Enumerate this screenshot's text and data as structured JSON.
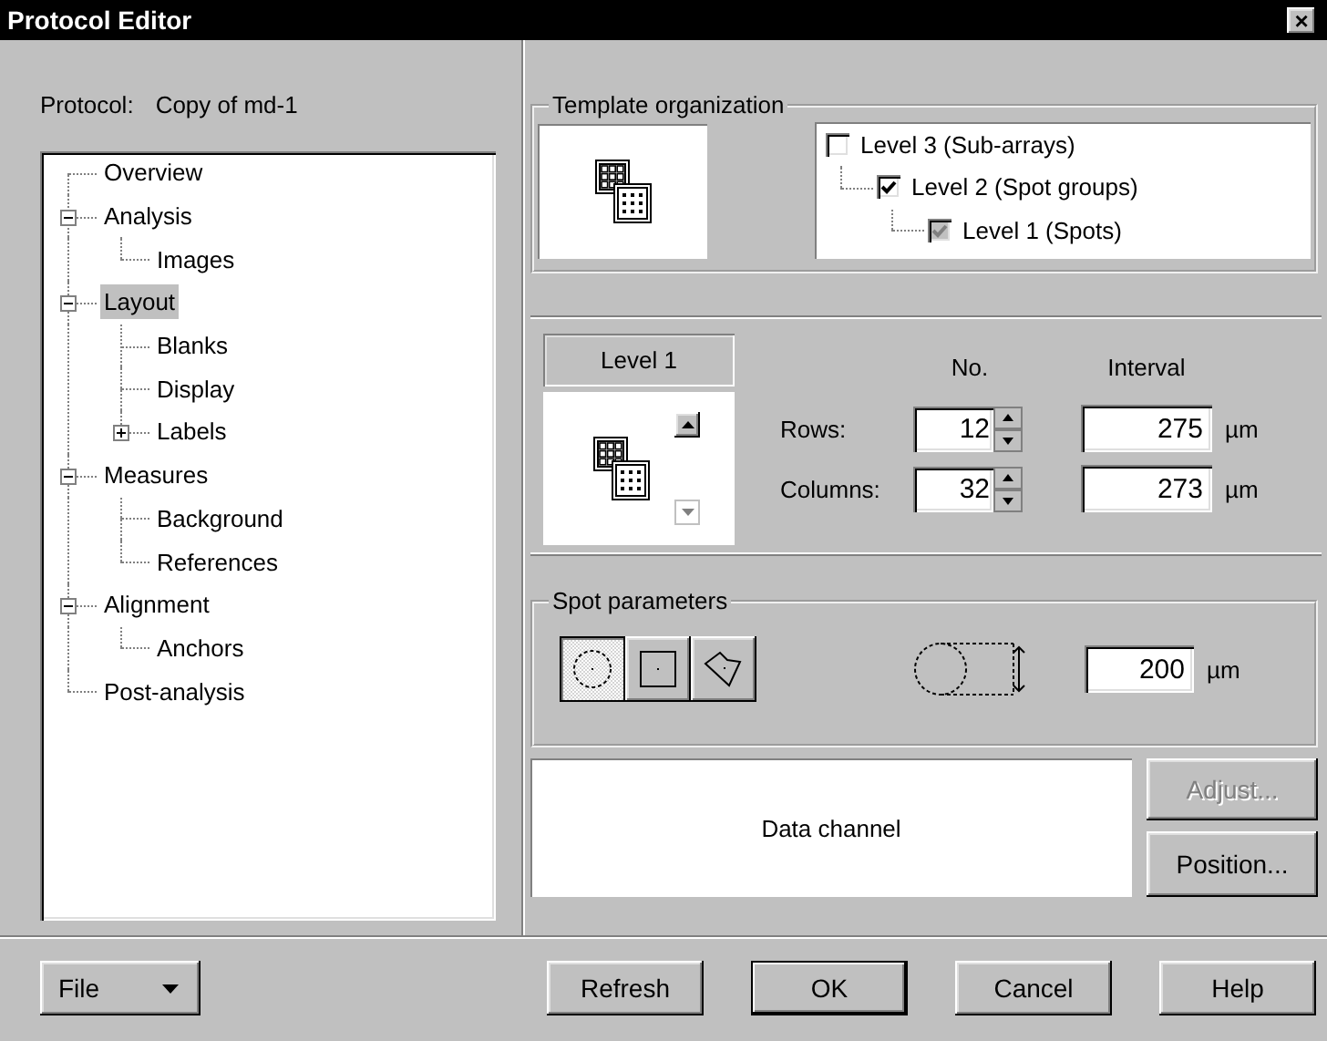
{
  "window": {
    "title": "Protocol Editor",
    "close": "×"
  },
  "protocol": {
    "label": "Protocol:",
    "name": "Copy of md-1"
  },
  "tree": [
    {
      "label": "Overview",
      "selected": false
    },
    {
      "label": "Analysis",
      "selected": false,
      "expanded": true,
      "children": [
        {
          "label": "Images",
          "selected": false
        }
      ]
    },
    {
      "label": "Layout",
      "selected": true,
      "expanded": true,
      "children": [
        {
          "label": "Blanks",
          "selected": false
        },
        {
          "label": "Display",
          "selected": false
        },
        {
          "label": "Labels",
          "selected": false,
          "expanded": false
        }
      ]
    },
    {
      "label": "Measures",
      "selected": false,
      "expanded": true,
      "children": [
        {
          "label": "Background",
          "selected": false
        },
        {
          "label": "References",
          "selected": false
        }
      ]
    },
    {
      "label": "Alignment",
      "selected": false,
      "expanded": true,
      "children": [
        {
          "label": "Anchors",
          "selected": false
        }
      ]
    },
    {
      "label": "Post-analysis",
      "selected": false
    }
  ],
  "template_organization": {
    "title": "Template organization",
    "levels": [
      {
        "label": "Level 3 (Sub-arrays)",
        "checked": false,
        "disabled": false,
        "children": [
          {
            "label": "Level 2 (Spot groups)",
            "checked": true,
            "disabled": false,
            "children": [
              {
                "label": "Level 1 (Spots)",
                "checked": true,
                "disabled": true
              }
            ]
          }
        ]
      }
    ]
  },
  "level_panel": {
    "title": "Level 1",
    "scroll_buttons": [
      {
        "kind": "up",
        "disabled": false
      },
      {
        "kind": "down",
        "disabled": true
      }
    ],
    "headers": [
      "No.",
      "Interval"
    ],
    "rows": [
      {
        "label": "Rows:",
        "count": "12",
        "interval": "275",
        "unit": "µm"
      },
      {
        "label": "Columns:",
        "count": "32",
        "interval": "273",
        "unit": "µm"
      }
    ]
  },
  "spot_parameters": {
    "title": "Spot parameters",
    "shapes": [
      {
        "kind": "circle",
        "selected": true
      },
      {
        "kind": "square",
        "selected": false
      },
      {
        "kind": "freeform",
        "selected": false
      }
    ],
    "diameter": "200",
    "unit": "µm"
  },
  "data_channel": {
    "label": "Data channel"
  },
  "side_buttons": [
    {
      "label": "Adjust...",
      "disabled": true
    },
    {
      "label": "Position...",
      "disabled": false
    }
  ],
  "footer": {
    "file_menu": "File",
    "buttons": [
      {
        "label": "Refresh",
        "default": false
      },
      {
        "label": "OK",
        "default": true
      },
      {
        "label": "Cancel",
        "default": false
      },
      {
        "label": "Help",
        "default": false
      }
    ]
  }
}
